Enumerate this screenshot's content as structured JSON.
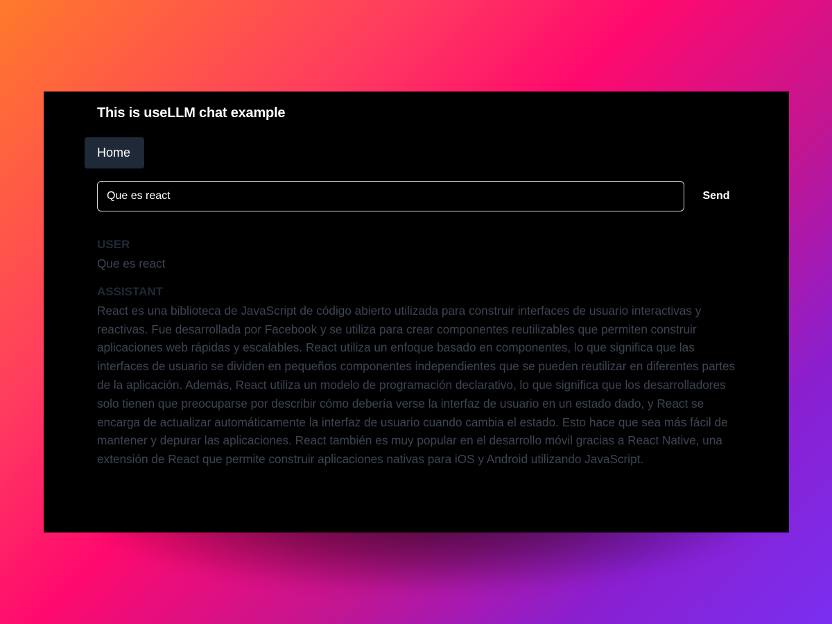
{
  "app": {
    "title": "This is useLLM chat example"
  },
  "nav": {
    "home_label": "Home"
  },
  "input": {
    "value": "Que es react",
    "send_label": "Send"
  },
  "messages": [
    {
      "role": "USER",
      "content": "Que es react"
    },
    {
      "role": "ASSISTANT",
      "content": "React es una biblioteca de JavaScript de código abierto utilizada para construir interfaces de usuario interactivas y reactivas. Fue desarrollada por Facebook y se utiliza para crear componentes reutilizables que permiten construir aplicaciones web rápidas y escalables. React utiliza un enfoque basado en componentes, lo que significa que las interfaces de usuario se dividen en pequeños componentes independientes que se pueden reutilizar en diferentes partes de la aplicación. Además, React utiliza un modelo de programación declarativo, lo que significa que los desarrolladores solo tienen que preocuparse por describir cómo debería verse la interfaz de usuario en un estado dado, y React se encarga de actualizar automáticamente la interfaz de usuario cuando cambia el estado. Esto hace que sea más fácil de mantener y depurar las aplicaciones. React también es muy popular en el desarrollo móvil gracias a React Native, una extensión de React que permite construir aplicaciones nativas para iOS y Android utilizando JavaScript."
    }
  ],
  "colors": {
    "background_gradient": [
      "#ff7a2b",
      "#ff0a6e",
      "#c21592",
      "#7a2ff0"
    ],
    "window_bg": "#000000",
    "nav_active_bg": "#1f2937",
    "role_text": "#1f2937",
    "message_text": "#3d4552"
  }
}
